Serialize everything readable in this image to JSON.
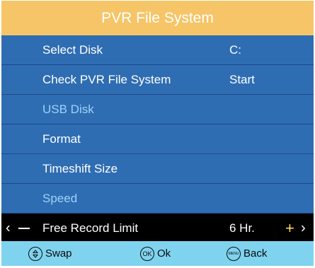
{
  "title": "PVR File System",
  "rows": [
    {
      "label": "Select Disk",
      "value": "C:"
    },
    {
      "label": "Check PVR File System",
      "value": "Start"
    },
    {
      "label": "USB Disk",
      "value": ""
    },
    {
      "label": "Format",
      "value": ""
    },
    {
      "label": "Timeshift Size",
      "value": ""
    },
    {
      "label": "Speed",
      "value": ""
    },
    {
      "label": "Free Record Limit",
      "value": "6 Hr."
    }
  ],
  "selected": {
    "left_arrow": "‹",
    "right_arrow": "›",
    "plus": "+"
  },
  "footer": {
    "swap_label": "Swap",
    "ok_icon": "OK",
    "ok_label": "Ok",
    "menu_icon": "MENU",
    "back_label": "Back"
  },
  "colors": {
    "title_bar": "#f6c567",
    "menu_bg": "#2f6db3",
    "selected_bg": "#000000",
    "footer_bg": "#7fd3ef",
    "disabled_text": "#9fd1f7"
  }
}
